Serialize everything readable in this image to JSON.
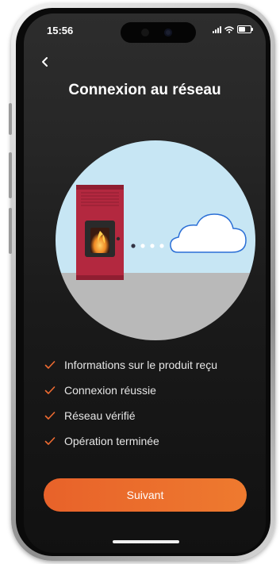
{
  "status_bar": {
    "time": "15:56"
  },
  "page": {
    "title": "Connexion au réseau"
  },
  "checklist": [
    {
      "label": "Informations sur le produit reçu",
      "icon": "check-icon"
    },
    {
      "label": "Connexion réussie",
      "icon": "check-icon"
    },
    {
      "label": "Réseau vérifié",
      "icon": "check-icon"
    },
    {
      "label": "Opération terminée",
      "icon": "check-icon"
    }
  ],
  "actions": {
    "next_label": "Suivant"
  },
  "colors": {
    "accent": "#ee7a2f",
    "stove_red": "#b3283f",
    "sky": "#c7e6f4",
    "floor": "#b9b9b9"
  }
}
